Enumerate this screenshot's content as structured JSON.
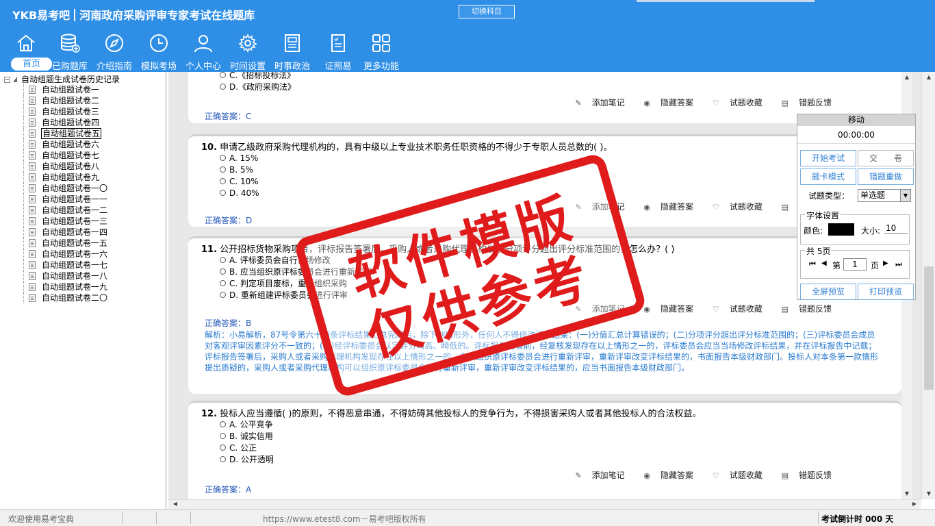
{
  "header": {
    "logo": "YKB易考吧",
    "app_title": "河南政府采购评审专家考试在线题库",
    "switch_label": "切换科目",
    "nav": [
      {
        "label": "首页",
        "icon": "home-icon"
      },
      {
        "label": "已购题库",
        "icon": "database-icon"
      },
      {
        "label": "介绍指南",
        "icon": "compass-icon"
      },
      {
        "label": "模拟考场",
        "icon": "clock-icon"
      },
      {
        "label": "个人中心",
        "icon": "user-icon"
      },
      {
        "label": "时间设置",
        "icon": "gear-icon"
      },
      {
        "label": "时事政治",
        "icon": "newspaper-icon"
      },
      {
        "label": "证照易",
        "icon": "certificate-icon"
      },
      {
        "label": "更多功能",
        "icon": "grid-icon"
      }
    ]
  },
  "sidebar": {
    "root": "自动组题生成试卷历史记录",
    "items": [
      "自动组题试卷一",
      "自动组题试卷二",
      "自动组题试卷三",
      "自动组题试卷四",
      "自动组题试卷五",
      "自动组题试卷六",
      "自动组题试卷七",
      "自动组题试卷八",
      "自动组题试卷九",
      "自动组题试卷一〇",
      "自动组题试卷一一",
      "自动组题试卷一二",
      "自动组题试卷一三",
      "自动组题试卷一四",
      "自动组题试卷一五",
      "自动组题试卷一六",
      "自动组题试卷一七",
      "自动组题试卷一八",
      "自动组题试卷一九",
      "自动组题试卷二〇"
    ],
    "selected_index": 4
  },
  "actions": {
    "note": "添加笔记",
    "hide": "隐藏答案",
    "fav": "试题收藏",
    "report": "错题反馈"
  },
  "questions": {
    "q9": {
      "options": [
        "C.《招标投标法》",
        "D.《政府采购法》"
      ],
      "answer": "正确答案：C"
    },
    "q10": {
      "number": "10.",
      "text": "申请乙级政府采购代理机构的，具有中级以上专业技术职务任职资格的不得少于专职人员总数的(  )。",
      "options": [
        "A. 15%",
        "B. 5%",
        "C. 10%",
        "D. 40%"
      ],
      "answer": "正确答案：D"
    },
    "q11": {
      "number": "11.",
      "text": "公开招标货物采购项目，评标报告签署后，采购人或者采购代理机构发现分项评分超出评分标准范围的，怎么办？(  )",
      "options": [
        "A. 评标委员会自行当场修改",
        "B. 应当组织原评标委员会进行重新评审",
        "C. 判定项目废标，重新组织采购",
        "D. 重新组建评标委员会进行评审"
      ],
      "answer": "正确答案：B",
      "analysis": "解析：小易解析，87号令第六十四条评标结果汇总完成后，除下列情形外，任何人不得修改评标结果：(一)分值汇总计算错误的；(二)分项评分超出评分标准范围的；(三)评标委员会成员对客观评审因素评分不一致的；(四)经评标委员会认定评分畸高、畸低的。评标报告签署前，经复核发现存在以上情形之一的，评标委员会应当当场修改评标结果，并在评标报告中记载；评标报告签署后，采购人或者采购代理机构发现存在以上情形之一的，应当组织原评标委员会进行重新评审，重新评审改变评标结果的，书面报告本级财政部门。投标人对本条第一款情形提出质疑的，采购人或者采购代理机构可以组织原评标委员会进行重新评审，重新评审改变评标结果的，应当书面报告本级财政部门。"
    },
    "q12": {
      "number": "12.",
      "text": "投标人应当遵循(  )的原则，不得恶意串通，不得妨碍其他投标人的竞争行为，不得损害采购人或者其他投标人的合法权益。",
      "options": [
        "A. 公平竞争",
        "B. 诚实信用",
        "C. 公正",
        "D. 公开透明"
      ],
      "answer": "正确答案：A"
    }
  },
  "panel": {
    "title": "移动",
    "timer": "00:00:00",
    "start": "开始考试",
    "submit": "交　　卷",
    "card_mode": "题卡模式",
    "redo": "错题重做",
    "type_label": "试题类型：",
    "type_value": "单选题",
    "font_legend": "字体设置",
    "color_label": "颜色:",
    "size_label": "大小:",
    "size_value": "10",
    "pages_legend": "共 5页",
    "page_prefix": "第",
    "page_value": "1",
    "page_suffix": "页",
    "fullscreen": "全屏预览",
    "print": "打印预览"
  },
  "status": {
    "left": "欢迎使用易考宝典",
    "url": "https://www.etest8.com－易考吧版权所有",
    "right": "考试倒计时 000 天"
  },
  "watermark": {
    "line1": "软件模版",
    "line2": "仅供参考"
  }
}
